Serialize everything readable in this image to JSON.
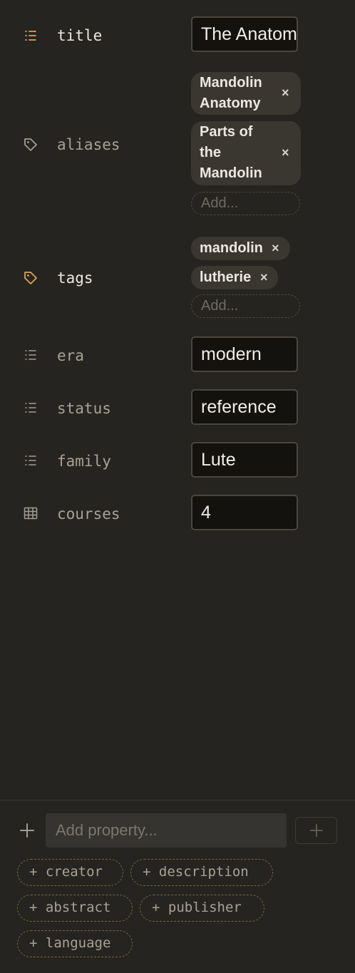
{
  "colors": {
    "accent": "#d9a552",
    "muted_icon": "#a39d92",
    "background": "#262420",
    "input_bg": "#14120f"
  },
  "properties": {
    "title": {
      "icon": "list-icon",
      "name": "title",
      "value": "The Anatomy of the Mandolin"
    },
    "aliases": {
      "icon": "tag-icon",
      "name": "aliases",
      "items": [
        {
          "line1": "Mandolin",
          "line2": "Anatomy"
        },
        {
          "line1": "Parts of",
          "line2": "the",
          "line3": "Mandolin"
        }
      ],
      "add_placeholder": "Add..."
    },
    "tags": {
      "icon": "tag-icon",
      "name": "tags",
      "items": [
        "mandolin",
        "lutherie"
      ],
      "add_placeholder": "Add..."
    },
    "era": {
      "icon": "list-icon",
      "name": "era",
      "value": "modern"
    },
    "status": {
      "icon": "list-icon",
      "name": "status",
      "value": "reference"
    },
    "family": {
      "icon": "list-icon",
      "name": "family",
      "value": "Lute"
    },
    "courses": {
      "icon": "number-grid-icon",
      "name": "courses",
      "value": "4"
    }
  },
  "remove_glyph": "×",
  "footer": {
    "add_property_placeholder": "Add property...",
    "suggestions": [
      {
        "plus": "+",
        "label": "creator"
      },
      {
        "plus": "+",
        "label": "description"
      },
      {
        "plus": "+",
        "label": "abstract"
      },
      {
        "plus": "+",
        "label": "publisher"
      },
      {
        "plus": "+",
        "label": "language"
      }
    ]
  }
}
